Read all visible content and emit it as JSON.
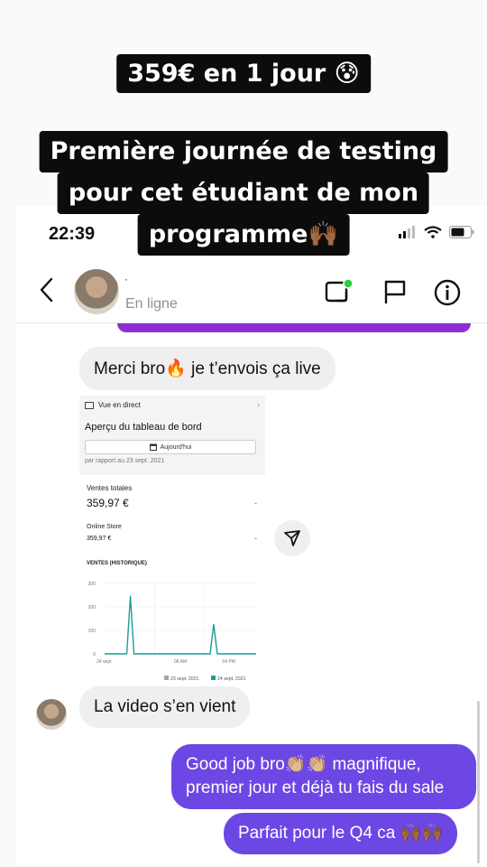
{
  "captions": {
    "line1": "359€ en 1 jour 😰",
    "line2a": "Première journée de testing",
    "line2b": "pour cet étudiant de mon",
    "line2c": "programme🙌🏾"
  },
  "status_bar": {
    "time": "22:39"
  },
  "header": {
    "contact_name": "·",
    "status": "En ligne"
  },
  "messages": [
    {
      "from": "contact",
      "text": "Merci bro🔥 je t’envois ça live"
    },
    {
      "from": "contact",
      "text": "La video s’en vient"
    },
    {
      "from": "me",
      "text": "Good job bro👏🏼👏🏼 magnifique, premier jour et déjà tu fais du sale"
    },
    {
      "from": "me",
      "text": "Parfait pour le Q4 ca 🙌🏾🙌🏾"
    }
  ],
  "shared_screenshot": {
    "live_view": "Vue en direct",
    "title": "Aperçu du tableau de bord",
    "date_button": "Aujourd'hui",
    "compare": "par rapport au 23 sept. 2021",
    "total_sales_label": "Ventes totales",
    "total_sales_value": "359,97 €",
    "dash": "-",
    "online_store_label": "Online Store",
    "online_store_value": "359,97 €",
    "chart_label": "VENTES (HISTORIQUE)"
  },
  "chart_data": {
    "type": "line",
    "x_ticks": [
      "24 sept.",
      "08 AM",
      "04 PM"
    ],
    "ylim": [
      0,
      300
    ],
    "y_ticks": [
      "300",
      "200",
      "100",
      "0"
    ],
    "series": [
      {
        "name": "24 sept. 2021",
        "color": "#1a9d9a",
        "peaks": [
          {
            "x_frac": 0.17,
            "value": 245
          },
          {
            "x_frac": 0.72,
            "value": 125
          }
        ]
      },
      {
        "name": "23 sept. 2021",
        "color": "#9aa7b6",
        "peaks": []
      }
    ]
  },
  "colors": {
    "out_bubble": "#6c47e4",
    "in_bubble": "#efefef",
    "online_dot": "#2ecc40",
    "strip": "#8e2fd4"
  }
}
